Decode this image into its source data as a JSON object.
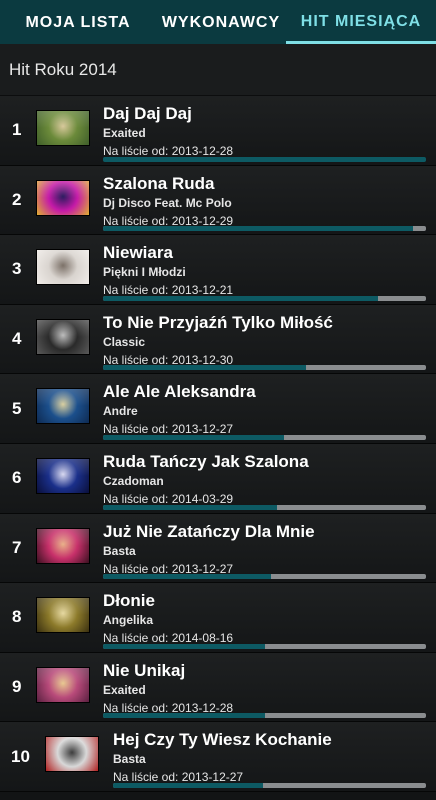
{
  "tabs": [
    {
      "label": "MOJA LISTA",
      "active": false
    },
    {
      "label": "WYKONAWCY",
      "active": false
    },
    {
      "label": "HIT MIESIĄCA",
      "active": true
    }
  ],
  "header": {
    "title": "Hit Roku 2014"
  },
  "colors": {
    "accent": "#7fdfe6",
    "tabbar": "#0b3a40",
    "progress_fill": "#0d5a63",
    "progress_track": "#8a8d8f"
  },
  "since_prefix": "Na liście od: ",
  "items": [
    {
      "rank": "1",
      "title": "Daj Daj Daj",
      "artist": "Exaited",
      "since": "2013-12-28",
      "progress": 1.0,
      "thumb": [
        "#6b8a3a",
        "#d7c89a",
        "#3f5e2a"
      ]
    },
    {
      "rank": "2",
      "title": "Szalona Ruda",
      "artist": "Dj Disco Feat. Mc Polo",
      "since": "2013-12-29",
      "progress": 0.96,
      "thumb": [
        "#c51aa8",
        "#2a1b5e",
        "#e0b030"
      ]
    },
    {
      "rank": "3",
      "title": "Niewiara",
      "artist": "Piękni I Młodzi",
      "since": "2013-12-21",
      "progress": 0.85,
      "thumb": [
        "#d9d4cf",
        "#7a6f66",
        "#f0ece8"
      ]
    },
    {
      "rank": "4",
      "title": "To Nie Przyjaźń Tylko Miłość",
      "artist": "Classic",
      "since": "2013-12-30",
      "progress": 0.63,
      "thumb": [
        "#2a2a2a",
        "#bcbcbc",
        "#5a5a5a"
      ]
    },
    {
      "rank": "5",
      "title": "Ale Ale Aleksandra",
      "artist": "Andre",
      "since": "2013-12-27",
      "progress": 0.56,
      "thumb": [
        "#1b4f8c",
        "#d9cfa0",
        "#0e2a52"
      ]
    },
    {
      "rank": "6",
      "title": "Ruda Tańczy Jak Szalona",
      "artist": "Czadoman",
      "since": "2014-03-29",
      "progress": 0.54,
      "thumb": [
        "#1a2f8a",
        "#d8d8f0",
        "#0a0f3a"
      ]
    },
    {
      "rank": "7",
      "title": "Już Nie Zatańczy Dla Mnie",
      "artist": "Basta",
      "since": "2013-12-27",
      "progress": 0.52,
      "thumb": [
        "#c7306a",
        "#e8b088",
        "#3a1020"
      ]
    },
    {
      "rank": "8",
      "title": "Dłonie",
      "artist": "Angelika",
      "since": "2014-08-16",
      "progress": 0.5,
      "thumb": [
        "#8c7a2a",
        "#e6d8a0",
        "#3a3010"
      ]
    },
    {
      "rank": "9",
      "title": "Nie Unikaj",
      "artist": "Exaited",
      "since": "2013-12-28",
      "progress": 0.5,
      "thumb": [
        "#b84a7a",
        "#e8c890",
        "#5a2040"
      ]
    },
    {
      "rank": "10",
      "title": "Hej Czy Ty Wiesz Kochanie",
      "artist": "Basta",
      "since": "2013-12-27",
      "progress": 0.48,
      "thumb": [
        "#d8d8d8",
        "#3a3a3a",
        "#b02020"
      ]
    }
  ]
}
